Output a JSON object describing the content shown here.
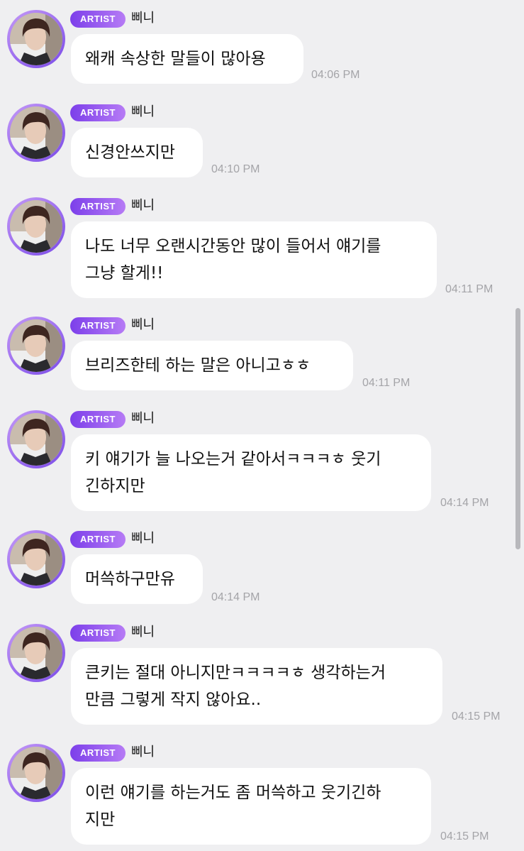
{
  "artist_badge": "ARTIST",
  "sender_name": "삐니",
  "messages": [
    {
      "lines": [
        "왜캐 속상한 말들이 많아용"
      ],
      "time": "04:06 PM"
    },
    {
      "lines": [
        "신경안쓰지만"
      ],
      "time": "04:10 PM"
    },
    {
      "lines": [
        "나도 너무 오랜시간동안 많이 들어서 얘기를",
        "그냥 할게!!"
      ],
      "time": "04:11 PM"
    },
    {
      "lines": [
        "브리즈한테 하는 말은 아니고ㅎㅎ"
      ],
      "time": "04:11 PM"
    },
    {
      "lines": [
        "키 얘기가 늘 나오는거 같아서ㅋㅋㅋㅎ 웃기",
        "긴하지만"
      ],
      "time": "04:14 PM"
    },
    {
      "lines": [
        "머쓱하구만유"
      ],
      "time": "04:14 PM"
    },
    {
      "lines": [
        "큰키는 절대 아니지만ㅋㅋㅋㅋㅎ 생각하는거",
        "만큼 그렇게 작지 않아요.."
      ],
      "time": "04:15 PM"
    },
    {
      "lines": [
        "이런 얘기를 하는거도 좀 머쓱하고 웃기긴하",
        "지만"
      ],
      "time": "04:15 PM"
    }
  ],
  "colors": {
    "background": "#efeff1",
    "bubble": "#ffffff",
    "badge_start": "#7c3fea",
    "badge_end": "#b67bf5",
    "time_text": "#a4a4a8"
  }
}
